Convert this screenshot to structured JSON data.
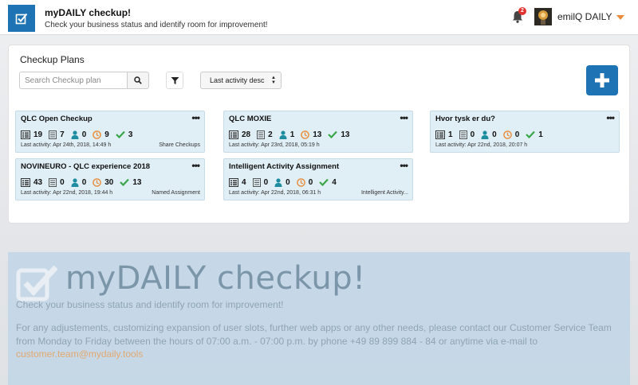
{
  "header": {
    "title": "myDAILY checkup!",
    "subtitle": "Check your business status and identify room for improvement!",
    "notification_count": "2",
    "user_name": "emilQ DAILY"
  },
  "panel": {
    "title": "Checkup Plans",
    "search_placeholder": "Search Checkup plan",
    "sort_selected": "Last activity desc"
  },
  "cards": [
    {
      "title": "QLC Open Checkup",
      "stats": [
        "19",
        "7",
        "0",
        "9",
        "3"
      ],
      "activity": "Last activity: Apr 24th, 2018, 14:49 h",
      "tag": "Share Checkups"
    },
    {
      "title": "QLC MOXIE",
      "stats": [
        "28",
        "2",
        "1",
        "13",
        "13"
      ],
      "activity": "Last activity: Apr 23rd, 2018, 05:19 h",
      "tag": ""
    },
    {
      "title": "Hvor tysk er du?",
      "stats": [
        "1",
        "0",
        "0",
        "0",
        "1"
      ],
      "activity": "Last activity: Apr 22nd, 2018, 20:07 h",
      "tag": ""
    },
    {
      "title": "NOVINEURO - QLC experience 2018",
      "stats": [
        "43",
        "0",
        "0",
        "30",
        "13"
      ],
      "activity": "Last activity: Apr 22nd, 2018, 19:44 h",
      "tag": "Named Assignment"
    },
    {
      "title": "Intelligent Activity Assignment",
      "stats": [
        "4",
        "0",
        "0",
        "0",
        "4"
      ],
      "activity": "Last activity: Apr 22nd, 2018, 06:31 h",
      "tag": "Intelligent Activity..."
    }
  ],
  "promo": {
    "title": "myDAILY checkup!",
    "subtitle": "Check your business status and identify room for improvement!",
    "text": "For any adjustements, customizing expansion of user slots, further web apps or any other needs, please contact our Customer Service Team from Monday to Friday between the hours of 07:00 a.m. - 07:00 p.m. by phone +49 89 899 884 - 84 or anytime via e-mail to",
    "email": "customer.team@mydaily.tools"
  },
  "colors": {
    "brand_blue": "#1e73b4",
    "card_bg": "#e0eef6",
    "accent_orange": "#e98b3a",
    "check_green": "#3aa64a",
    "person_teal": "#1e8da0"
  },
  "icons": [
    "checkbox-logo-icon",
    "bell-icon",
    "search-icon",
    "filter-icon",
    "plus-icon",
    "checklist-icon",
    "document-icon",
    "person-icon",
    "clock-icon",
    "checkmark-icon"
  ]
}
